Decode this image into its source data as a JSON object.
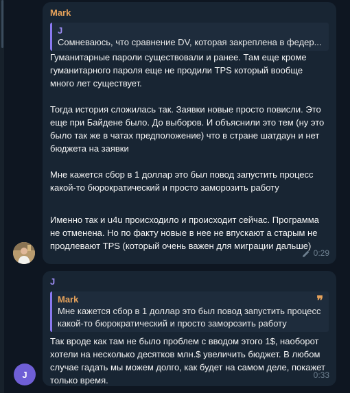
{
  "messages": [
    {
      "sender": "Mark",
      "reply": {
        "name": "J",
        "text": "Сомневаюсь, что сравнение DV, которая закреплена в федер..."
      },
      "paragraphs": [
        "Гуманитарные пароли существовали и ранее. Там еще кроме гуманитарного пароля еще не продили TPS который вообще много лет существует.",
        "Тогда история сложилась так. Заявки новые просто повисли. Это еще при Байдене было. До выборов. И объяснили это тем (ну это было так же в чатах предположение) что в стране шатдаун и нет бюджета на заявки",
        "Мне кажется сбор в 1 доллар это был повод запустить процесс какой-то бюрократический и просто заморозить работу",
        "Именно так и u4u происходило и происходит сейчас. Программа не отменена. Но по факту новые в нее не впускают а старым не продлевают TPS (который очень важен для миграции дальше)"
      ],
      "time": "0:29"
    },
    {
      "sender": "J",
      "avatar_letter": "J",
      "reply": {
        "name": "Mark",
        "text": "Мне кажется сбор в 1 доллар это был повод запустить процесс какой-то бюрократический и просто заморозить работу"
      },
      "paragraphs": [
        "Так вроде как там не было проблем с вводом этого 1$, наоборот хотели на несколько десятков млн.$ увеличить бюджет. В любом случае гадать мы можем долго, как будет на самом деле, покажет только время."
      ],
      "time": "0:33"
    }
  ],
  "colors": {
    "background": "#0e1621",
    "bubble": "#182533",
    "accent_orange": "#e6a25b",
    "accent_purple": "#9b8cf3"
  },
  "icons": [
    "pencil-icon",
    "quote-icon"
  ]
}
